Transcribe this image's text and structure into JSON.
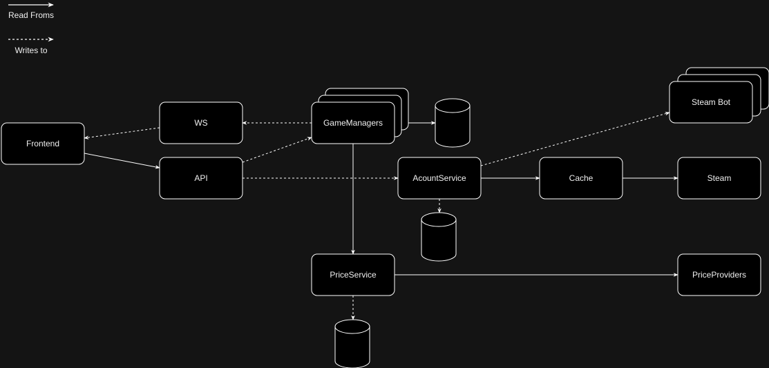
{
  "legend": {
    "read_label": "Read Froms",
    "write_label": "Writes to"
  },
  "colors": {
    "background": "#141414",
    "node_fill": "#000000",
    "stroke": "#ffffff",
    "text": "#f0f0f0"
  },
  "nodes": [
    {
      "id": "frontend",
      "label": "Frontend",
      "shape": "box"
    },
    {
      "id": "ws",
      "label": "WS",
      "shape": "box"
    },
    {
      "id": "api",
      "label": "API",
      "shape": "box"
    },
    {
      "id": "gamemanagers",
      "label": "GameManagers",
      "shape": "stacked-box"
    },
    {
      "id": "db1",
      "label": "",
      "shape": "database"
    },
    {
      "id": "acountservice",
      "label": "AcountService",
      "shape": "box"
    },
    {
      "id": "db2",
      "label": "",
      "shape": "database"
    },
    {
      "id": "cache",
      "label": "Cache",
      "shape": "box"
    },
    {
      "id": "steam",
      "label": "Steam",
      "shape": "box"
    },
    {
      "id": "steambot",
      "label": "Steam Bot",
      "shape": "stacked-box"
    },
    {
      "id": "priceservice",
      "label": "PriceService",
      "shape": "box"
    },
    {
      "id": "db3",
      "label": "",
      "shape": "database"
    },
    {
      "id": "priceproviders",
      "label": "PriceProviders",
      "shape": "box"
    }
  ],
  "edges": [
    {
      "from": "ws",
      "to": "frontend",
      "type": "writes"
    },
    {
      "from": "frontend",
      "to": "api",
      "type": "reads"
    },
    {
      "from": "gamemanagers",
      "to": "ws",
      "type": "writes"
    },
    {
      "from": "api",
      "to": "gamemanagers",
      "type": "writes"
    },
    {
      "from": "gamemanagers",
      "to": "db1",
      "type": "reads"
    },
    {
      "from": "api",
      "to": "acountservice",
      "type": "writes"
    },
    {
      "from": "acountservice",
      "to": "steambot",
      "type": "writes"
    },
    {
      "from": "acountservice",
      "to": "cache",
      "type": "reads"
    },
    {
      "from": "cache",
      "to": "steam",
      "type": "reads"
    },
    {
      "from": "acountservice",
      "to": "db2",
      "type": "writes"
    },
    {
      "from": "gamemanagers",
      "to": "priceservice",
      "type": "reads"
    },
    {
      "from": "priceservice",
      "to": "priceproviders",
      "type": "reads"
    },
    {
      "from": "priceservice",
      "to": "db3",
      "type": "writes"
    }
  ]
}
